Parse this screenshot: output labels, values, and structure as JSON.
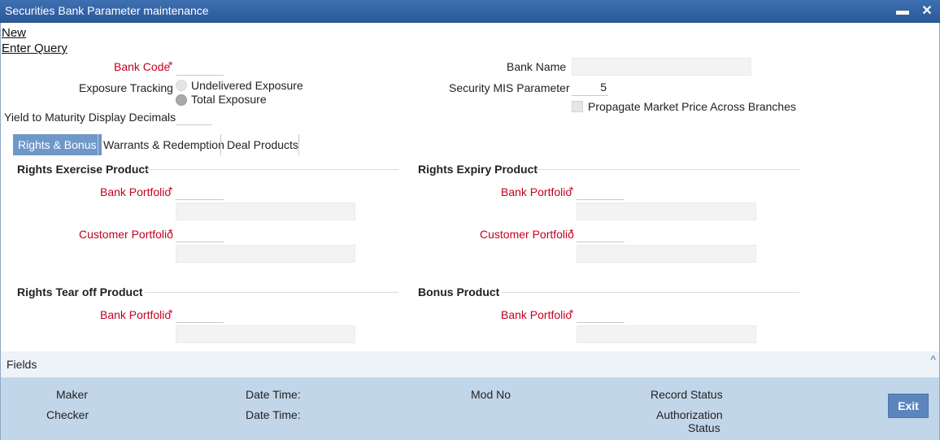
{
  "window": {
    "title": "Securities Bank Parameter maintenance",
    "minimize_glyph": "▬",
    "close_glyph": "✕"
  },
  "menu": {
    "new": "New",
    "enter_query": "Enter Query"
  },
  "header": {
    "bank_code_label": "Bank Code",
    "bank_code_value": "",
    "bank_name_label": "Bank Name",
    "bank_name_value": "",
    "exposure_tracking_label": "Exposure Tracking",
    "exposure_options": [
      {
        "label": "Undelivered Exposure",
        "selected": false
      },
      {
        "label": "Total Exposure",
        "selected": true
      }
    ],
    "security_mis_label": "Security MIS Parameter",
    "security_mis_value": "5",
    "propagate_label": "Propagate Market Price Across Branches",
    "propagate_checked": false,
    "ytm_label": "Yield to Maturity Display Decimals",
    "ytm_value": ""
  },
  "tabs": [
    {
      "label": "Rights & Bonus",
      "active": true
    },
    {
      "label": "Warrants & Redemption",
      "active": false
    },
    {
      "label": "Deal Products",
      "active": false
    }
  ],
  "sections": {
    "rights_exercise": {
      "title": "Rights Exercise Product",
      "bank_portfolio_label": "Bank Portfolio",
      "customer_portfolio_label": "Customer Portfolio"
    },
    "rights_expiry": {
      "title": "Rights Expiry Product",
      "bank_portfolio_label": "Bank Portfolio",
      "customer_portfolio_label": "Customer Portfolio"
    },
    "rights_tearoff": {
      "title": "Rights Tear off Product",
      "bank_portfolio_label": "Bank Portfolio"
    },
    "bonus": {
      "title": "Bonus Product",
      "bank_portfolio_label": "Bank Portfolio"
    }
  },
  "required_marker": "*",
  "fields_bar": {
    "label": "Fields",
    "chevron": "^"
  },
  "footer": {
    "maker": "Maker",
    "checker": "Checker",
    "date_time_1": "Date Time:",
    "date_time_2": "Date Time:",
    "mod_no": "Mod No",
    "record_status": "Record Status",
    "authorization_line1": "Authorization",
    "authorization_line2": "Status",
    "exit": "Exit"
  },
  "colors": {
    "title_bar": "#2f5e9e",
    "required": "#c3001f",
    "active_tab": "#6f97c8",
    "footer": "#c2d6ea",
    "exit_button": "#5b86bd"
  }
}
